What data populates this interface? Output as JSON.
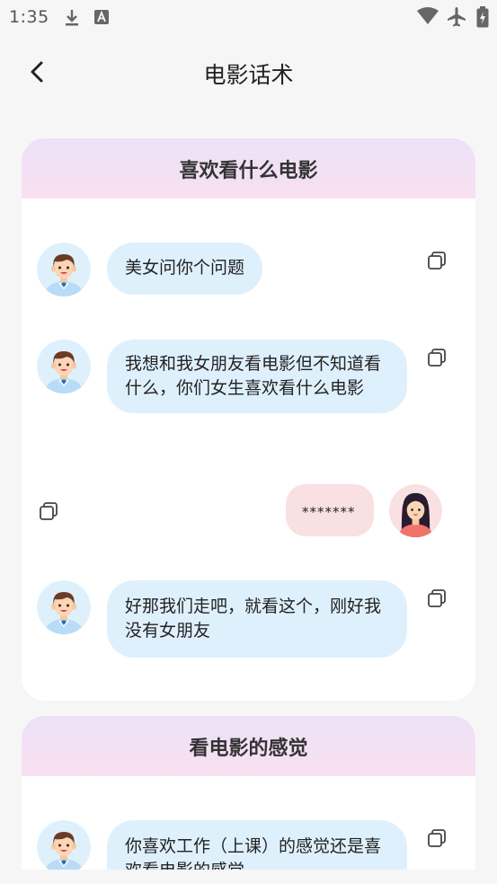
{
  "status_bar": {
    "time": "1:35",
    "icons": [
      "download-icon",
      "font-a-icon",
      "wifi-icon",
      "airplane-icon",
      "battery-charging-icon"
    ]
  },
  "header": {
    "title": "电影话术",
    "back_icon": "chevron-left-icon"
  },
  "sections": [
    {
      "title": "喜欢看什么电影",
      "messages": [
        {
          "side": "left",
          "text": "美女问你个问题"
        },
        {
          "side": "left",
          "text": "我想和我女朋友看电影但不知道看什么，你们女生喜欢看什么电影"
        },
        {
          "side": "right",
          "text": "*******"
        },
        {
          "side": "left",
          "text": "好那我们走吧，就看这个，刚好我没有女朋友"
        }
      ]
    },
    {
      "title": "看电影的感觉",
      "messages": [
        {
          "side": "left",
          "text": "你喜欢工作（上课）的感觉还是喜欢看电影的感觉"
        }
      ]
    }
  ],
  "colors": {
    "bubble_left": "#dff0fd",
    "bubble_right": "#f9e0e2",
    "header_gradient_top": "#ece1f7",
    "header_gradient_bottom": "#f8e0f1",
    "background": "#f6f6f6"
  }
}
